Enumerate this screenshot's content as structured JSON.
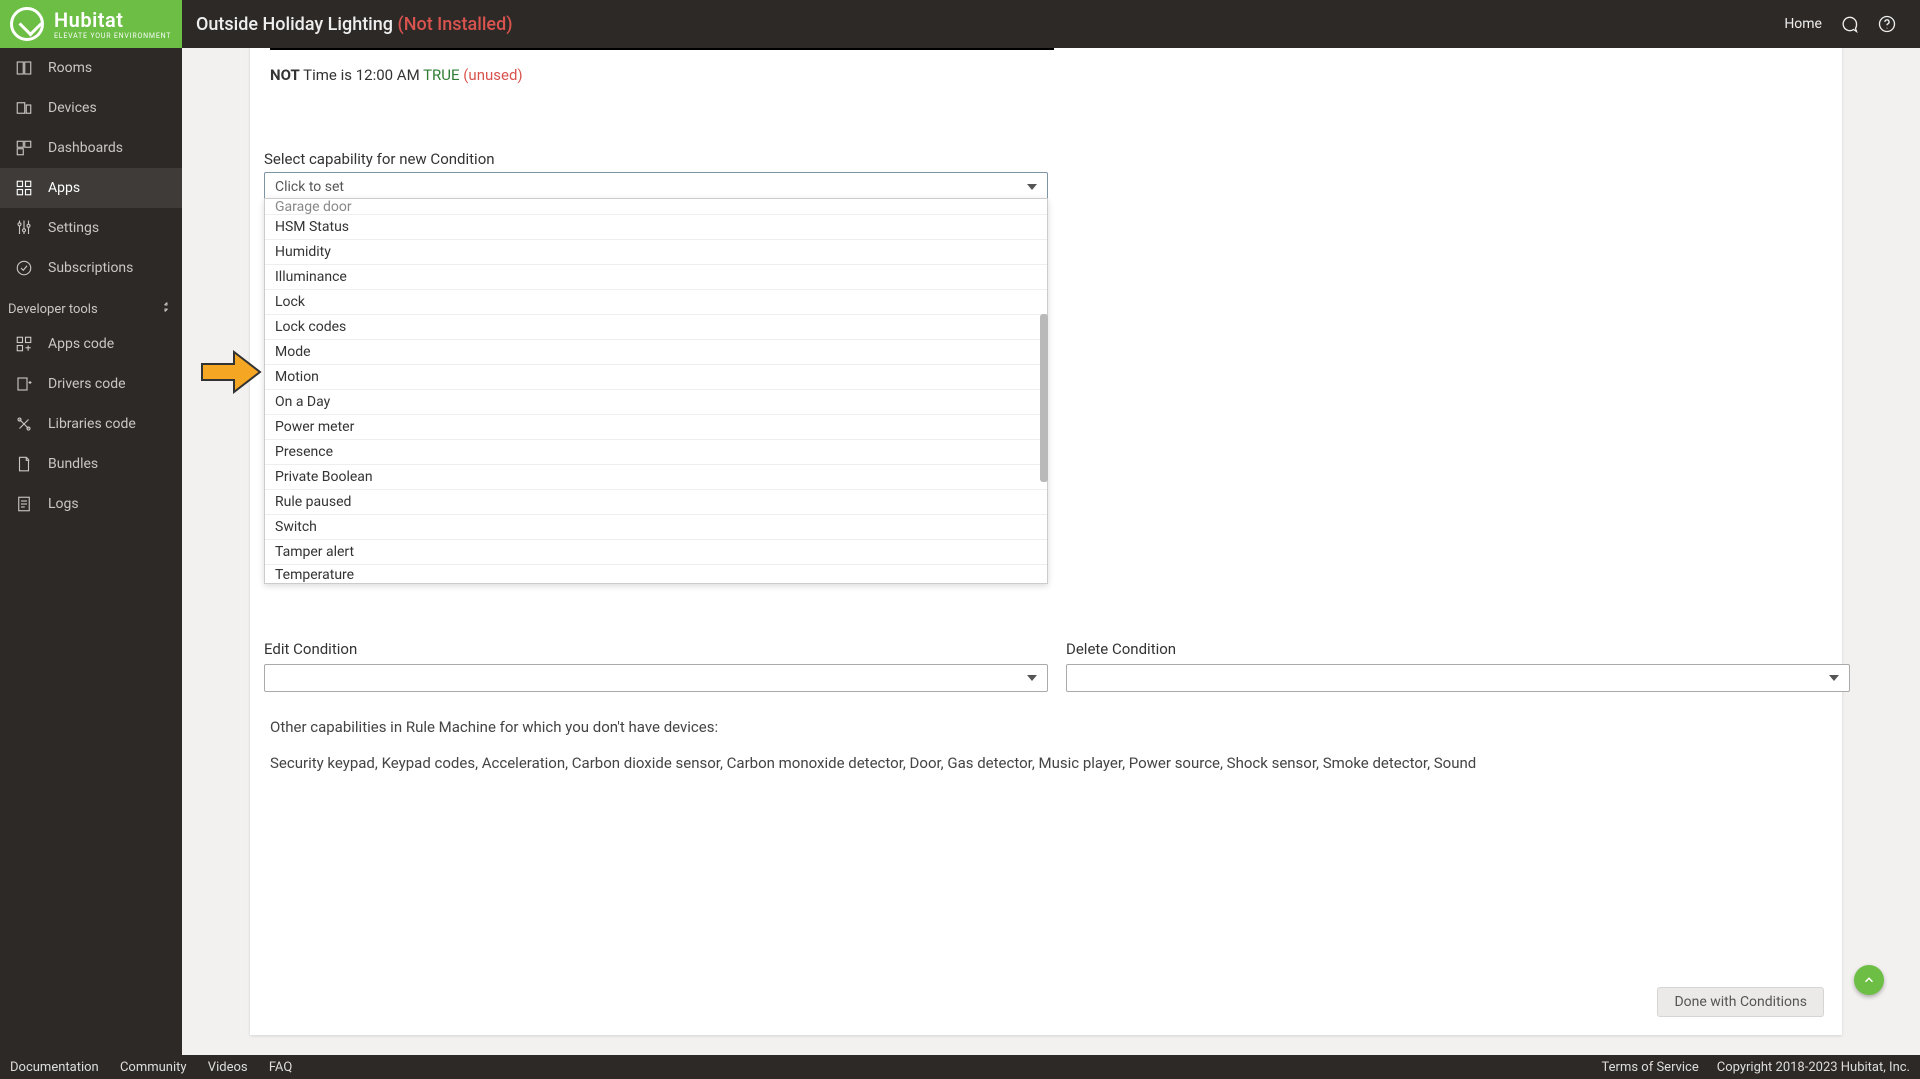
{
  "brand": {
    "name": "Hubitat",
    "tagline": "ELEVATE YOUR ENVIRONMENT"
  },
  "header": {
    "title": "Outside Holiday Lighting",
    "status": "(Not Installed)",
    "home": "Home"
  },
  "sidebar": {
    "items": [
      {
        "label": "Rooms"
      },
      {
        "label": "Devices"
      },
      {
        "label": "Dashboards"
      },
      {
        "label": "Apps"
      },
      {
        "label": "Settings"
      },
      {
        "label": "Subscriptions"
      }
    ],
    "dev_header": "Developer tools",
    "dev_items": [
      {
        "label": "Apps code"
      },
      {
        "label": "Drivers code"
      },
      {
        "label": "Libraries code"
      },
      {
        "label": "Bundles"
      },
      {
        "label": "Logs"
      }
    ]
  },
  "condition": {
    "not": "NOT",
    "body": "Time is 12:00 AM",
    "truth": "TRUE",
    "unused": "(unused)"
  },
  "capability": {
    "label": "Select capability for new Condition",
    "placeholder": "Click to set",
    "options": [
      "Garage door",
      "HSM Status",
      "Humidity",
      "Illuminance",
      "Lock",
      "Lock codes",
      "Mode",
      "Motion",
      "On a Day",
      "Power meter",
      "Presence",
      "Private Boolean",
      "Rule paused",
      "Switch",
      "Tamper alert",
      "Temperature"
    ]
  },
  "edit": {
    "label": "Edit Condition"
  },
  "delete": {
    "label": "Delete Condition"
  },
  "other": {
    "label": "Other capabilities for which you don't have devices:",
    "full_label": "Other capabilities in Rule Machine for which you don't have devices:",
    "list": "Security keypad, Keypad codes, Acceleration, Carbon dioxide sensor, Carbon monoxide detector, Door, Gas detector, Music player, Power source, Shock sensor, Smoke detector, Sound"
  },
  "done_label": "Done with Conditions",
  "footer": {
    "links": [
      "Documentation",
      "Community",
      "Videos",
      "FAQ"
    ],
    "tos": "Terms of Service",
    "copyright": "Copyright 2018-2023 Hubitat, Inc."
  }
}
